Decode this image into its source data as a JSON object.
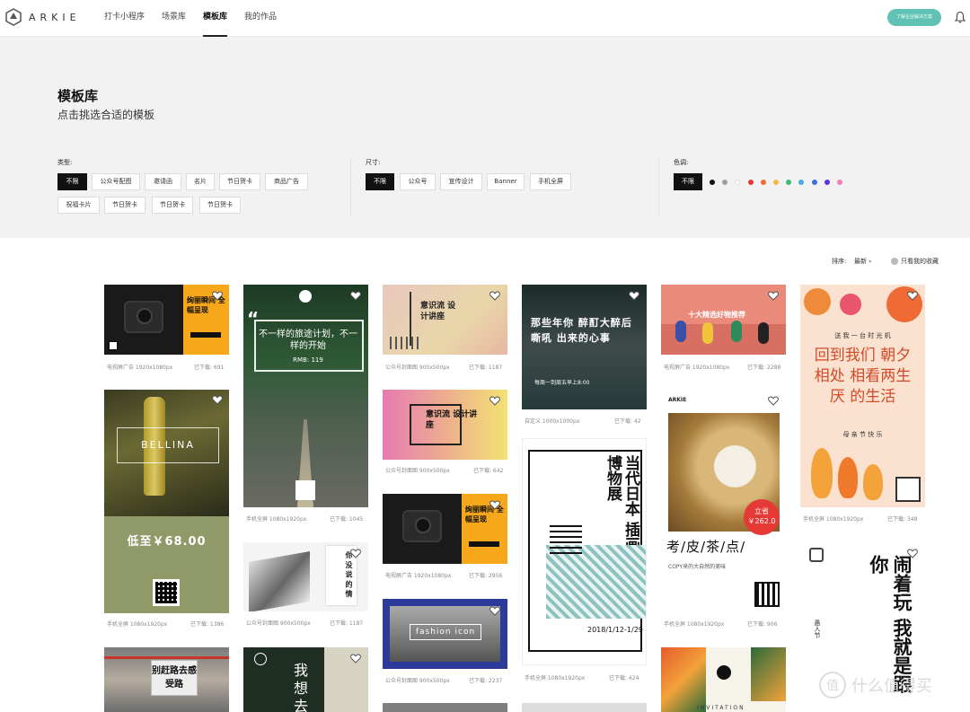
{
  "brand": {
    "name": "ARKIE"
  },
  "nav": {
    "items": [
      "打卡小程序",
      "场景库",
      "模板库",
      "我的作品"
    ],
    "active": "模板库"
  },
  "header": {
    "cta_label": "了解企业解决方案"
  },
  "hero": {
    "title": "模板库",
    "subtitle": "点击挑选合适的模板"
  },
  "filters": {
    "type": {
      "label": "类型:",
      "options": [
        "不限",
        "公众号配图",
        "邀请函",
        "名片",
        "节日贺卡",
        "商品广告",
        "祝福卡片",
        "节日贺卡",
        "节日贺卡",
        "节日贺卡"
      ],
      "selected": "不限"
    },
    "size": {
      "label": "尺寸:",
      "options": [
        "不限",
        "公众号",
        "宣传设计",
        "Banner",
        "手机全屏"
      ],
      "selected": "不限"
    },
    "color": {
      "label": "色调:",
      "options": [
        "不限"
      ],
      "selected": "不限",
      "swatches": [
        "#111111",
        "#9e9e9e",
        "#ffffff",
        "#e53935",
        "#f06a35",
        "#f6b73c",
        "#3cb878",
        "#4aa9e0",
        "#3f6fd6",
        "#5a36d6",
        "#f07eb4"
      ]
    }
  },
  "sort": {
    "label": "排序:",
    "value": "最新",
    "favorites_label": "只看我的收藏"
  },
  "templates": [
    {
      "meta": "电视屏广告 1920x1080px",
      "downloads": "已下载: 691",
      "title": "绚丽瞬间 全幅呈现"
    },
    {
      "meta": "手机全屏 1080x1920px",
      "downloads": "已下载: 1386",
      "title": "BELLINA",
      "price": "低至￥68.00"
    },
    {
      "meta": "手机全屏 1080x1920px",
      "downloads": "已下载: 1045",
      "title": "不一样的旅途计划，不一样的开始",
      "price": "RMB: 119"
    },
    {
      "meta": "公众号封面图 900x500px",
      "downloads": "已下载: 1187",
      "title": "你 没 说 的 情"
    },
    {
      "meta": "公众号封面图 900x500px",
      "downloads": "已下载: 1187",
      "title": "意识流 设计讲座"
    },
    {
      "meta": "公众号封面图 900x500px",
      "downloads": "已下载: 642",
      "title": "意识流 设计讲座"
    },
    {
      "meta": "电视屏广告 1920x1080px",
      "downloads": "已下载: 2956",
      "title": "绚丽瞬间 全幅呈现"
    },
    {
      "meta": "公众号封面图 900x500px",
      "downloads": "已下载: 2237",
      "title": "fashion icon"
    },
    {
      "meta": "自定义 1000x1000px",
      "downloads": "已下载: 42",
      "title": "那些年你 醉酊大醉后嘶吼 出来的心事",
      "extra": "每周一到周五早上8:00"
    },
    {
      "meta": "手机全屏 1080x1920px",
      "downloads": "已下载: 424",
      "title": "当代日本 插画博物展",
      "date": "2018/1/12-1/29"
    },
    {
      "meta": "电视屏广告 1920x1080px",
      "downloads": "已下载: 2288",
      "title": "十大精选好物推荐"
    },
    {
      "meta": "手机全屏 1080x1920px",
      "downloads": "已下载: 906",
      "title": "考/皮/茶/点/",
      "sub": "COPY来的大自然的美味",
      "price": "立省 ￥262.0"
    },
    {
      "meta": "手机全屏 1080x1920px",
      "downloads": "已下载: 348",
      "title": "回到我们 朝夕相处 相看两生厌 的生活",
      "top": "送 我 一 台 时 光 机",
      "bottom": "母 亲 节 快 乐"
    },
    {
      "title": "闹着玩 我就是跟你",
      "side": "愚人节"
    },
    {
      "title": "别赶路去感受路"
    },
    {
      "title": "我 想 去"
    },
    {
      "title": "INVITATION"
    }
  ],
  "watermark": {
    "text": "什么值得买"
  }
}
